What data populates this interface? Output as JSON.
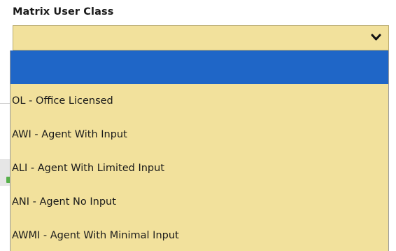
{
  "field": {
    "label": "Matrix User Class",
    "selected_value": "",
    "chevron_icon": "chevron-down-icon",
    "background_color": "#f2e19c",
    "highlight_color": "#1f66c7"
  },
  "options": [
    {
      "label": "",
      "highlighted": true
    },
    {
      "label": "OL - Office Licensed",
      "highlighted": false
    },
    {
      "label": "AWI - Agent With Input",
      "highlighted": false
    },
    {
      "label": "ALI - Agent With Limited Input",
      "highlighted": false
    },
    {
      "label": "ANI - Agent No Input",
      "highlighted": false
    },
    {
      "label": "AWMI - Agent With Minimal Input",
      "highlighted": false
    }
  ]
}
